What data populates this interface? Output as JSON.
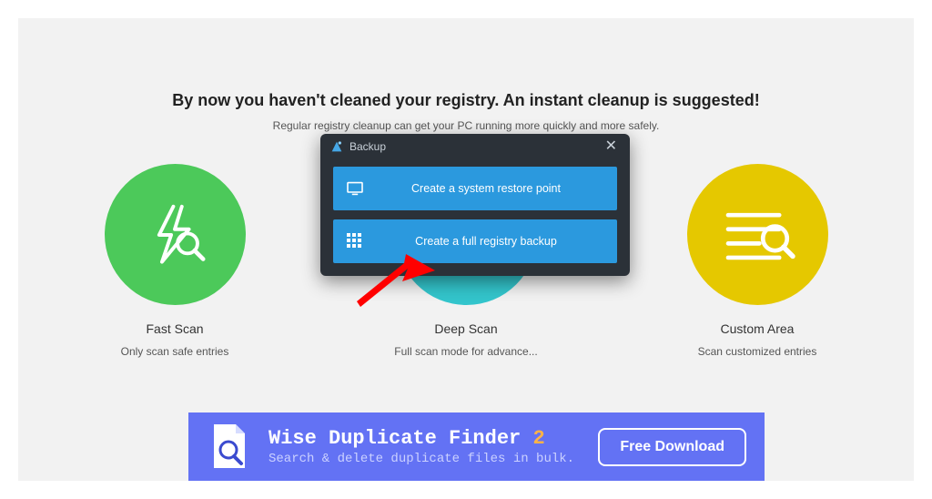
{
  "headline": "By now you haven't cleaned your registry. An instant cleanup is suggested!",
  "subhead": "Regular registry cleanup can get your PC running more quickly and more safely.",
  "options": [
    {
      "title": "Fast Scan",
      "desc": "Only scan safe entries"
    },
    {
      "title": "Deep Scan",
      "desc": "Full scan mode for advance..."
    },
    {
      "title": "Custom Area",
      "desc": "Scan customized entries"
    }
  ],
  "modal": {
    "title": "Backup",
    "btn1": "Create a system restore point",
    "btn2": "Create a full registry backup"
  },
  "banner": {
    "title_a": "Wise Duplicate Finder ",
    "title_b": "2",
    "sub": "Search & delete duplicate files in bulk.",
    "cta": "Free Download"
  }
}
